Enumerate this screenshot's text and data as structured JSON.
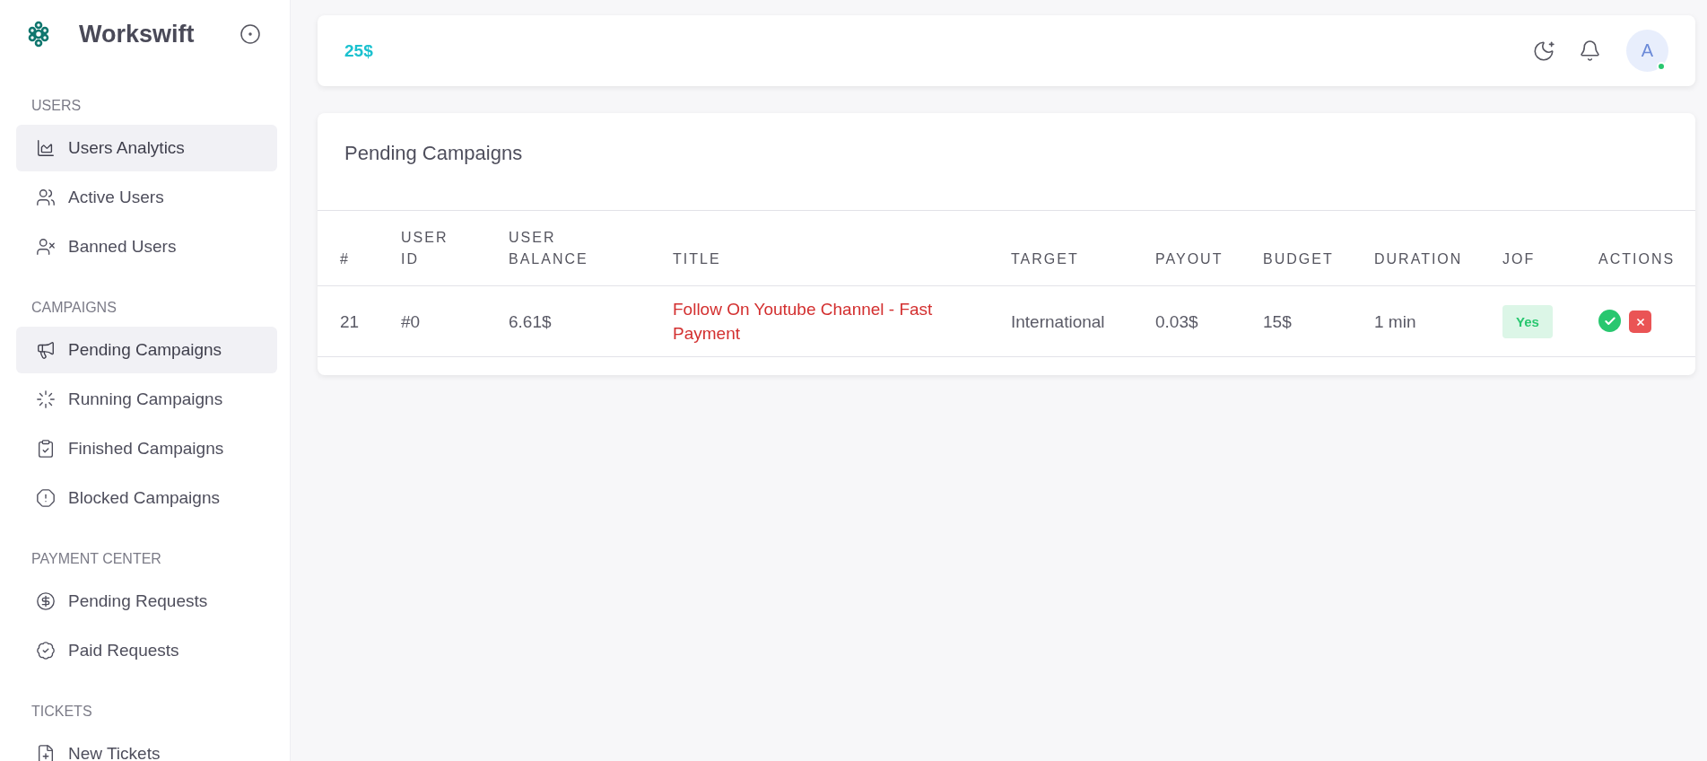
{
  "brand": {
    "name": "Workswift"
  },
  "sidebar": {
    "groups": [
      {
        "heading": "USERS",
        "items": [
          {
            "label": "Users Analytics",
            "selected": true
          },
          {
            "label": "Active Users",
            "selected": false
          },
          {
            "label": "Banned Users",
            "selected": false
          }
        ]
      },
      {
        "heading": "CAMPAIGNS",
        "items": [
          {
            "label": "Pending Campaigns",
            "selected": true
          },
          {
            "label": "Running Campaigns",
            "selected": false
          },
          {
            "label": "Finished Campaigns",
            "selected": false
          },
          {
            "label": "Blocked Campaigns",
            "selected": false
          }
        ]
      },
      {
        "heading": "PAYMENT CENTER",
        "items": [
          {
            "label": "Pending Requests",
            "selected": false
          },
          {
            "label": "Paid Requests",
            "selected": false
          }
        ]
      },
      {
        "heading": "TICKETS",
        "items": [
          {
            "label": "New Tickets",
            "selected": false
          }
        ]
      }
    ]
  },
  "topbar": {
    "balance": "25$",
    "avatar": {
      "initial": "A",
      "online": true
    }
  },
  "card": {
    "title": "Pending Campaigns",
    "columns": [
      [
        "#"
      ],
      [
        "USER",
        "ID"
      ],
      [
        "USER",
        "BALANCE"
      ],
      [
        "TITLE"
      ],
      [
        "TARGET"
      ],
      [
        "PAYOUT"
      ],
      [
        "BUDGET"
      ],
      [
        "DURATION"
      ],
      [
        "JOF"
      ],
      [
        "ACTIONS"
      ]
    ],
    "rows": [
      {
        "number": "21",
        "user_id": "#0",
        "user_balance": "6.61$",
        "title": "Follow On Youtube Channel - Fast Payment",
        "target": "International",
        "payout": "0.03$",
        "budget": "15$",
        "duration": "1 min",
        "jof": "Yes"
      }
    ]
  }
}
